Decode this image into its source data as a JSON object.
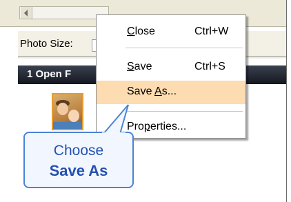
{
  "toolbar": {
    "photo_size_label": "Photo Size:",
    "open_files_title": "1 Open F"
  },
  "context_menu": {
    "items": [
      {
        "label_prefix": "",
        "label_underline": "C",
        "label_suffix": "lose",
        "shortcut": "Ctrl+W",
        "highlighted": false
      },
      {
        "label_prefix": "",
        "label_underline": "S",
        "label_suffix": "ave",
        "shortcut": "Ctrl+S",
        "highlighted": false
      },
      {
        "label_prefix": "Save ",
        "label_underline": "A",
        "label_suffix": "s...",
        "shortcut": "",
        "highlighted": true
      },
      {
        "label_prefix": "Pro",
        "label_underline": "p",
        "label_suffix": "erties...",
        "shortcut": "",
        "highlighted": false
      }
    ],
    "highlight_color": "#fcdcb0"
  },
  "callout": {
    "line1": "Choose",
    "line2": "Save As",
    "border_color": "#4a82d6",
    "text_color": "#2451b0"
  },
  "icons": {
    "scroll_left": "arrow-left-icon",
    "thumbnail": "photo-thumbnail"
  }
}
